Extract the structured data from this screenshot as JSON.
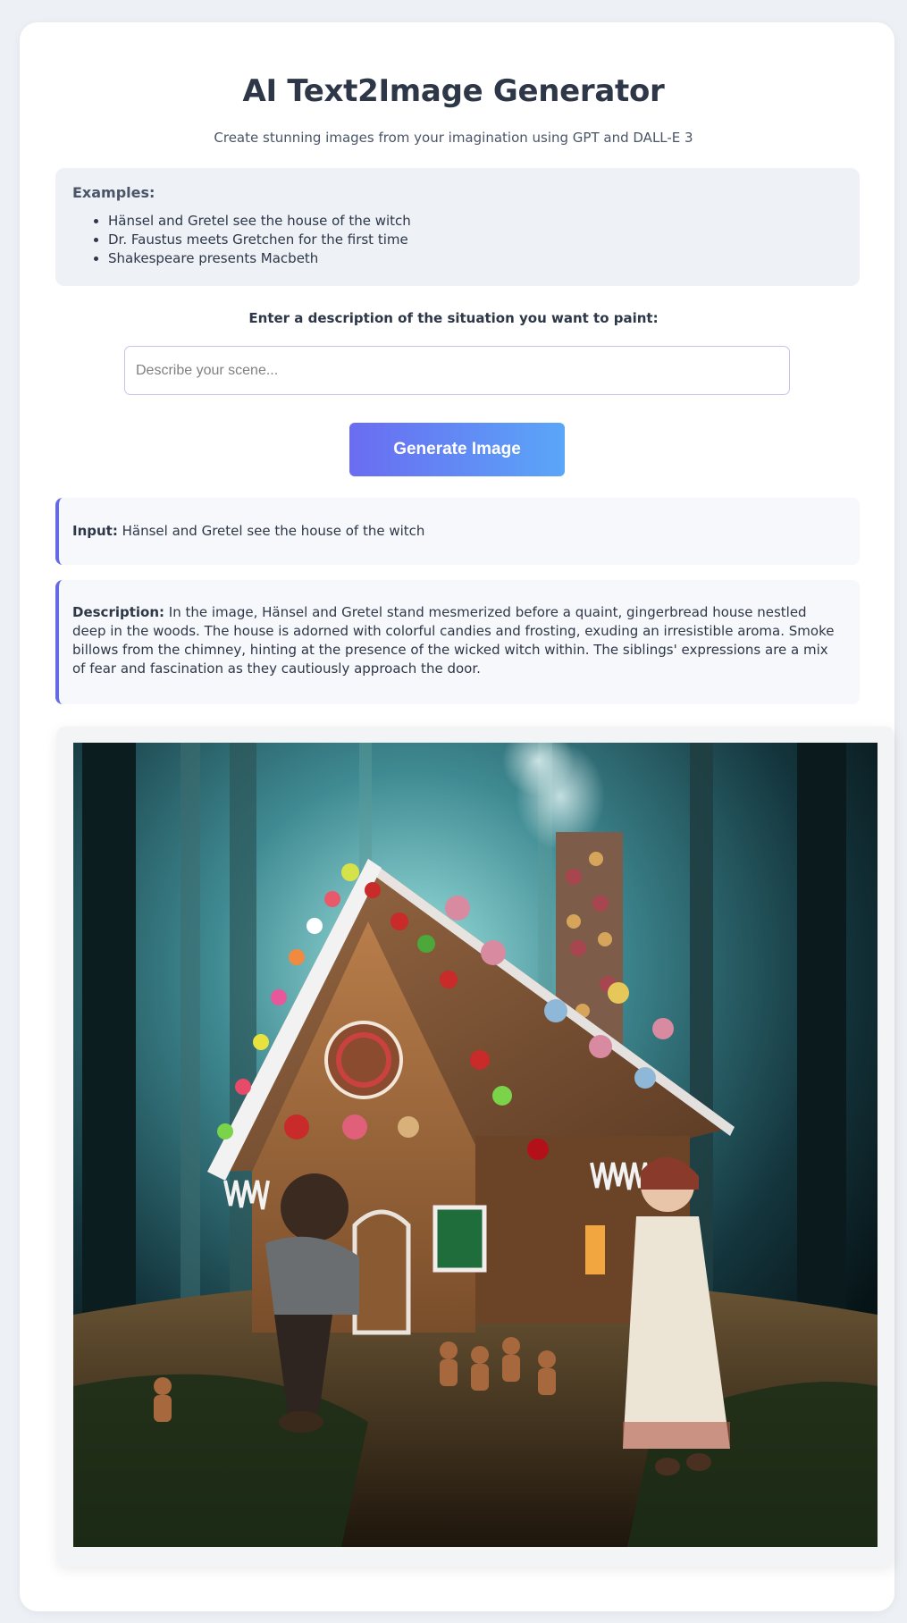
{
  "header": {
    "title": "AI Text2Image Generator",
    "subtitle": "Create stunning images from your imagination using GPT and DALL-E 3"
  },
  "examples": {
    "heading": "Examples:",
    "items": [
      "Hänsel and Gretel see the house of the witch",
      "Dr. Faustus meets Gretchen for the first time",
      "Shakespeare presents Macbeth"
    ]
  },
  "form": {
    "label": "Enter a description of the situation you want to paint:",
    "placeholder": "Describe your scene...",
    "value": "",
    "button_label": "Generate Image"
  },
  "result": {
    "input_label": "Input:",
    "input_text": "Hänsel and Gretel see the house of the witch",
    "description_label": "Description:",
    "description_text": "In the image, Hänsel and Gretel stand mesmerized before a quaint, gingerbread house nestled deep in the woods. The house is adorned with colorful candies and frosting, exuding an irresistible aroma. Smoke billows from the chimney, hinting at the presence of the wicked witch within. The siblings' expressions are a mix of fear and fascination as they cautiously approach the door."
  },
  "colors": {
    "accent": "#6669e6",
    "button_gradient_start": "#6a6cf1",
    "button_gradient_end": "#5aa6f8",
    "page_background": "#edf0f5"
  }
}
